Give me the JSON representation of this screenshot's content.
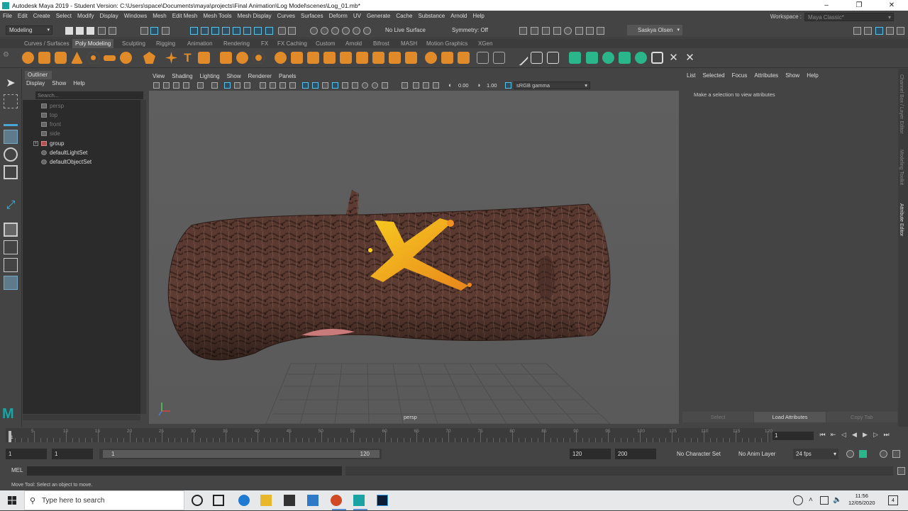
{
  "title": "Autodesk Maya 2019 - Student Version: C:\\Users\\space\\Documents\\maya\\projects\\Final Animation\\Log Model\\scenes\\Log_01.mb*",
  "window_controls": [
    "–",
    "❐",
    "✕"
  ],
  "menubar": [
    "File",
    "Edit",
    "Create",
    "Select",
    "Modify",
    "Display",
    "Windows",
    "Mesh",
    "Edit Mesh",
    "Mesh Tools",
    "Mesh Display",
    "Curves",
    "Surfaces",
    "Deform",
    "UV",
    "Generate",
    "Cache",
    "Substance",
    "Arnold",
    "Help"
  ],
  "workspace": {
    "label": "Workspace :",
    "value": "Maya Classic*"
  },
  "statusline": {
    "mode": "Modeling",
    "live_surface": "No Live Surface",
    "symmetry": "Symmetry: Off",
    "user": "Saskya Olsen"
  },
  "shelf_tabs": [
    "Curves / Surfaces",
    "Poly Modeling",
    "Sculpting",
    "Rigging",
    "Animation",
    "Rendering",
    "FX",
    "FX Caching",
    "Custom",
    "Arnold",
    "Bifrost",
    "MASH",
    "Motion Graphics",
    "XGen"
  ],
  "shelf_active": "Poly Modeling",
  "outliner": {
    "tab": "Outliner",
    "menu": [
      "Display",
      "Show",
      "Help"
    ],
    "search_placeholder": "Search...",
    "items": [
      {
        "label": "persp",
        "dim": true,
        "icon": "camera-icon"
      },
      {
        "label": "top",
        "dim": true,
        "icon": "camera-icon"
      },
      {
        "label": "front",
        "dim": true,
        "icon": "camera-icon"
      },
      {
        "label": "side",
        "dim": true,
        "icon": "camera-icon"
      },
      {
        "label": "group",
        "dim": false,
        "icon": "group-icon"
      },
      {
        "label": "defaultLightSet",
        "dim": false,
        "icon": "set-icon"
      },
      {
        "label": "defaultObjectSet",
        "dim": false,
        "icon": "set-icon"
      }
    ]
  },
  "viewport": {
    "menu": [
      "View",
      "Shading",
      "Lighting",
      "Show",
      "Renderer",
      "Panels"
    ],
    "exposure": "0.00",
    "gamma": "1.00",
    "colorspace": "sRGB gamma",
    "camera": "persp"
  },
  "attribute_editor": {
    "menu": [
      "List",
      "Selected",
      "Focus",
      "Attributes",
      "Show",
      "Help"
    ],
    "message": "Make a selection to view attributes",
    "buttons": [
      "Select",
      "Load Attributes",
      "Copy Tab"
    ]
  },
  "side_tabs": [
    "Channel Box / Layer Editor",
    "Modeling Toolkit",
    "Attribute Editor"
  ],
  "timeline": {
    "ticks": [
      "5",
      "10",
      "15",
      "20",
      "25",
      "30",
      "35",
      "40",
      "45",
      "50",
      "55",
      "60",
      "65",
      "70",
      "75",
      "80",
      "85",
      "90",
      "95",
      "100",
      "105",
      "110",
      "115",
      "120"
    ],
    "current_frame": "1",
    "start_marker": "1"
  },
  "range": {
    "start": "1",
    "playback_start": "1",
    "range_start_label": "1",
    "range_end_label": "120",
    "playback_end": "120",
    "end": "200",
    "character_set": "No Character Set",
    "anim_layer": "No Anim Layer",
    "fps": "24 fps"
  },
  "cmdline": {
    "label": "MEL"
  },
  "helpline": "Move Tool: Select an object to move.",
  "taskbar": {
    "search": "Type here to search",
    "time": "11:56",
    "date": "12/05/2020",
    "notif": "4"
  },
  "colors": {
    "bg": "#444444",
    "panel_dark": "#2b2b2b",
    "accent_blue": "#5bc1e6",
    "maya_teal": "#1aa3a3",
    "bark": "#5a3a30",
    "paint_yellow": "#f0c020"
  }
}
